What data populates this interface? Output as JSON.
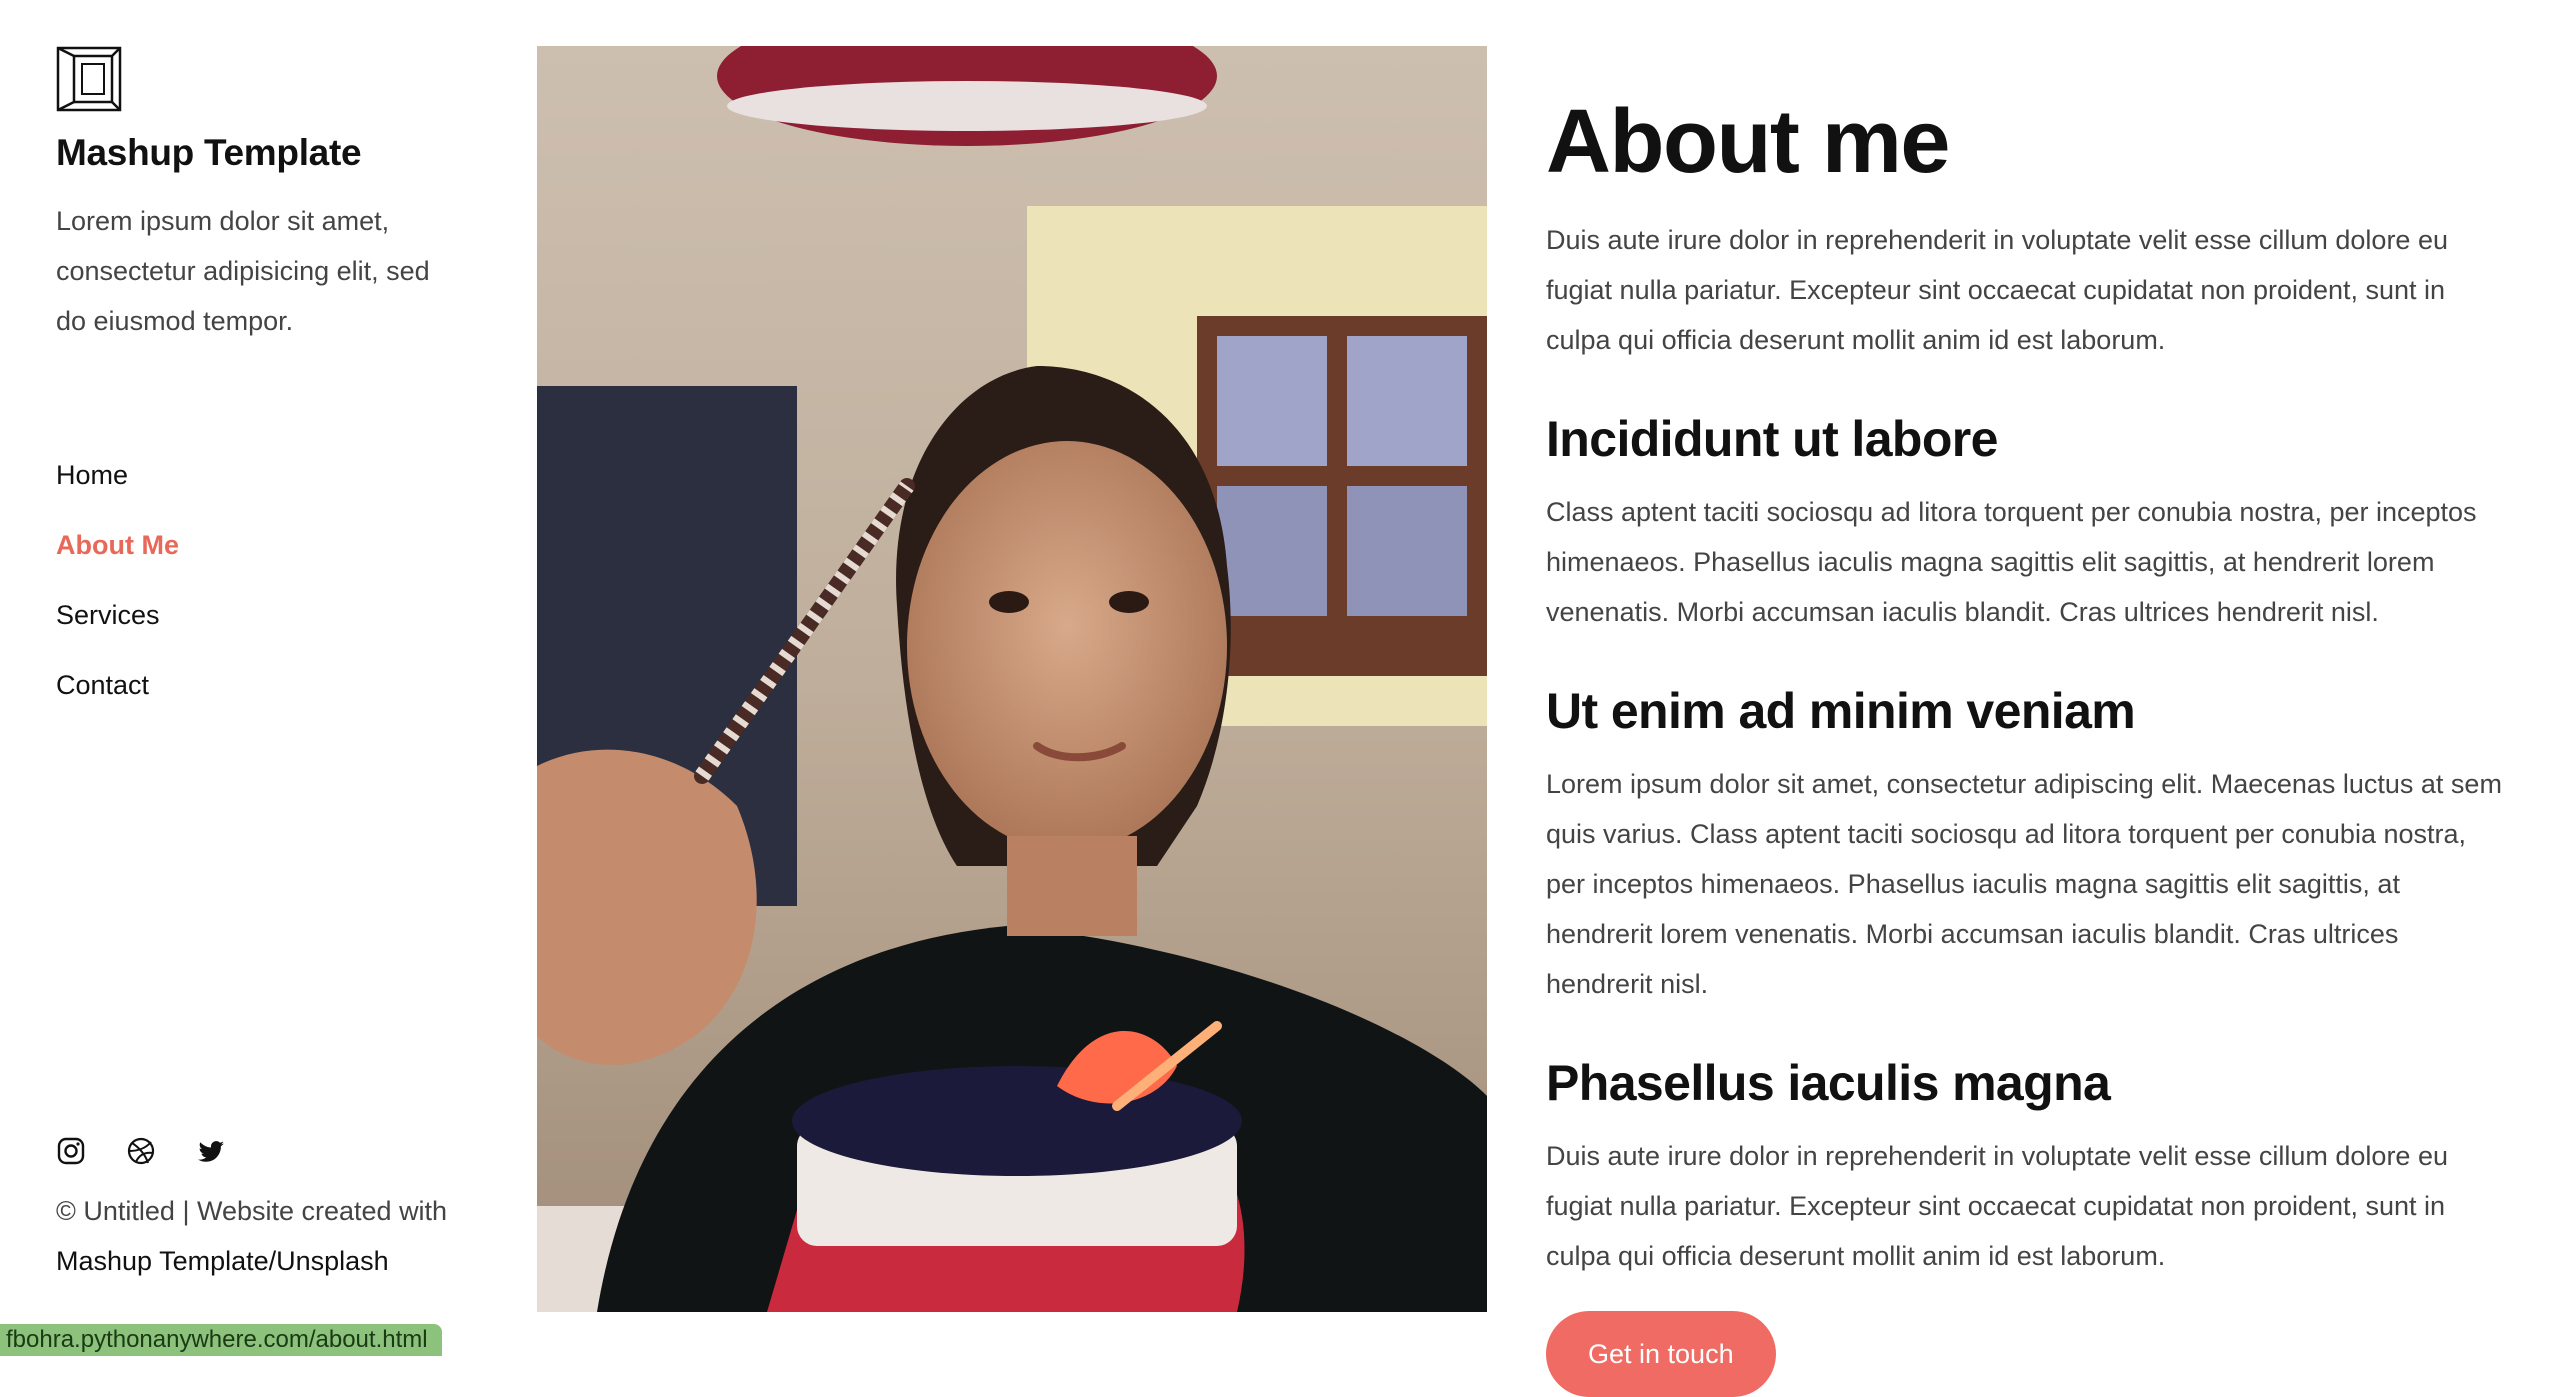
{
  "brand": {
    "logo_icon": "cube-frame-icon",
    "name": "Mashup Template",
    "tagline": "Lorem ipsum dolor sit amet, consectetur adipisicing elit, sed do eiusmod tempor."
  },
  "nav": {
    "items": [
      {
        "label": "Home",
        "active": false
      },
      {
        "label": "About Me",
        "active": true
      },
      {
        "label": "Services",
        "active": false
      },
      {
        "label": "Contact",
        "active": false
      }
    ]
  },
  "social": {
    "icons": [
      "instagram-icon",
      "dribbble-icon",
      "twitter-icon"
    ]
  },
  "footer": {
    "copyright": "© Untitled | Website created with",
    "link1": "Mashup Template",
    "separator": "/",
    "link2": "Unsplash"
  },
  "main": {
    "title": "About me",
    "intro": "Duis aute irure dolor in reprehenderit in voluptate velit esse cillum dolore eu fugiat nulla pariatur. Excepteur sint occaecat cupidatat non proident, sunt in culpa qui officia deserunt mollit anim id est laborum.",
    "sections": [
      {
        "heading": "Incididunt ut labore",
        "body": "Class aptent taciti sociosqu ad litora torquent per conubia nostra, per inceptos himenaeos. Phasellus iaculis magna sagittis elit sagittis, at hendrerit lorem venenatis. Morbi accumsan iaculis blandit. Cras ultrices hendrerit nisl."
      },
      {
        "heading": "Ut enim ad minim veniam",
        "body": "Lorem ipsum dolor sit amet, consectetur adipiscing elit. Maecenas luctus at sem quis varius. Class aptent taciti sociosqu ad litora torquent per conubia nostra, per inceptos himenaeos. Phasellus iaculis magna sagittis elit sagittis, at hendrerit lorem venenatis. Morbi accumsan iaculis blandit. Cras ultrices hendrerit nisl."
      },
      {
        "heading": "Phasellus iaculis magna",
        "body": "Duis aute irure dolor in reprehenderit in voluptate velit esse cillum dolore eu fugiat nulla pariatur. Excepteur sint occaecat cupidatat non proident, sunt in culpa qui officia deserunt mollit anim id est laborum."
      }
    ],
    "cta_label": "Get in touch"
  },
  "status_url": "fbohra.pythonanywhere.com/about.html",
  "colors": {
    "accent": "#e8685a",
    "button": "#ef6b63",
    "status": "#8cc27c"
  }
}
